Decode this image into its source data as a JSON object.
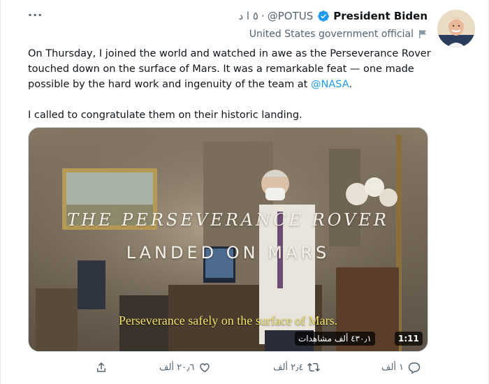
{
  "tweet": {
    "display_name": "President Biden",
    "handle": "@POTUS",
    "separator": "·",
    "time": "٥ ا د",
    "account_label": "United States government official",
    "text_part1": "On Thursday, I joined the world and watched in awe as the Perseverance Rover touched down on the surface of Mars. It was a remarkable feat — one made possible by the hard work and ingenuity of the team at ",
    "mention": "@NASA",
    "text_part1_end": ".",
    "text_part2": "I called to congratulate them on their historic landing.",
    "more_label": "···"
  },
  "media": {
    "title_line1": "THE PERSEVERANCE ROVER",
    "title_line2": "LANDED ON MARS",
    "caption": "Perseverance safely on the surface of Mars.",
    "duration": "1:11",
    "views": "٤٣٠٫١ ألف مشاهدات"
  },
  "actions": {
    "reply_count": "١ ألف",
    "retweet_count": "٢٫٤ ألف",
    "like_count": "٢٠٫٦ ألف"
  },
  "icons": {
    "verified": "verified-badge-icon",
    "flag": "government-flag-icon",
    "reply": "reply-icon",
    "retweet": "retweet-icon",
    "like": "heart-icon",
    "share": "share-icon",
    "more": "more-icon"
  },
  "colors": {
    "verified_blue": "#1d9bf0",
    "mention_blue": "#1d9bf0",
    "secondary_text": "#536471",
    "caption_yellow": "#f1e26a"
  }
}
